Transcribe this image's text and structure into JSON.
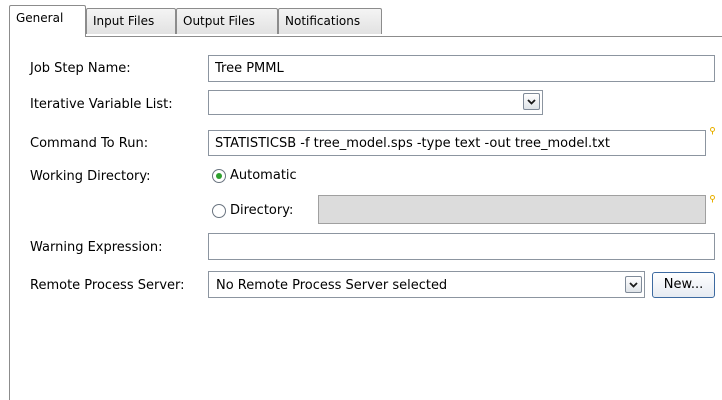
{
  "tabs": [
    {
      "label": "General",
      "active": true
    },
    {
      "label": "Input Files",
      "active": false
    },
    {
      "label": "Output Files",
      "active": false
    },
    {
      "label": "Notifications",
      "active": false
    }
  ],
  "form": {
    "job_step_name": {
      "label": "Job Step Name:",
      "value": "Tree PMML"
    },
    "iterative_variable_list": {
      "label": "Iterative Variable List:",
      "value": ""
    },
    "command_to_run": {
      "label": "Command To Run:",
      "value": "STATISTICSB -f tree_model.sps -type text -out tree_model.txt"
    },
    "working_directory": {
      "label": "Working Directory:",
      "automatic_label": "Automatic",
      "directory_label": "Directory:",
      "selected": "Automatic",
      "directory_value": ""
    },
    "warning_expression": {
      "label": "Warning Expression:",
      "value": ""
    },
    "remote_process_server": {
      "label": "Remote Process Server:",
      "value": "No Remote Process Server selected",
      "new_button": "New..."
    }
  },
  "colors": {
    "radio_dot": "#2ea02e",
    "hint_icon": "#e8b000"
  },
  "icons": {
    "dropdown": "chevron-down-icon",
    "hint": "hint-bulb-icon"
  }
}
